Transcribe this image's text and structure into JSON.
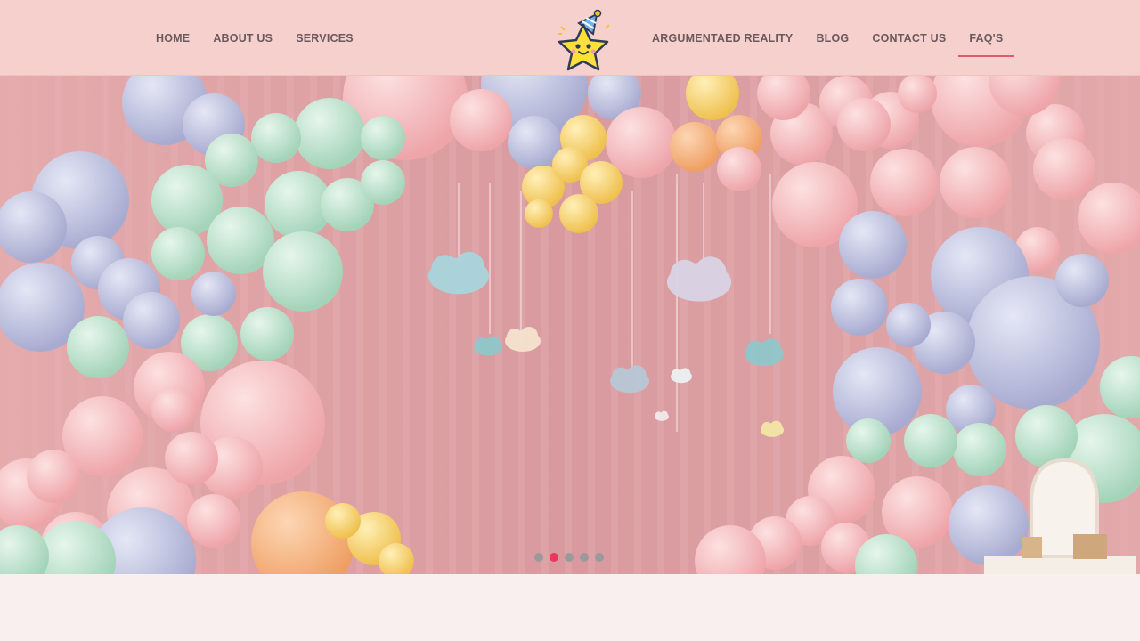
{
  "nav": {
    "left_items": [
      {
        "label": "HOME"
      },
      {
        "label": "ABOUT US"
      },
      {
        "label": "SERVICES"
      }
    ],
    "right_items": [
      {
        "label": "ARGUMENTAED REALITY"
      },
      {
        "label": "BLOG"
      },
      {
        "label": "CONTACT US"
      },
      {
        "label": "FAQ'S",
        "active": true
      }
    ],
    "logo_icon": "party-star-logo-icon"
  },
  "hero": {
    "image": "pastel-balloon-arch-with-hanging-clouds",
    "colors": {
      "pink": "#f2b4b6",
      "lavender": "#c3c6e2",
      "mint": "#bfe3cf",
      "yellow": "#f6d07a",
      "peach": "#f3b07e",
      "wall": "#dba1a4"
    }
  },
  "carousel": {
    "slide_count": 5,
    "active_index": 1
  },
  "colors": {
    "navbar_bg": "#f6d0cd",
    "nav_text": "#6b5a5d",
    "active_underline": "#e05a6c",
    "page_bg": "#f8efee",
    "dot": "#9a9a9a",
    "dot_active": "#e8385c"
  }
}
